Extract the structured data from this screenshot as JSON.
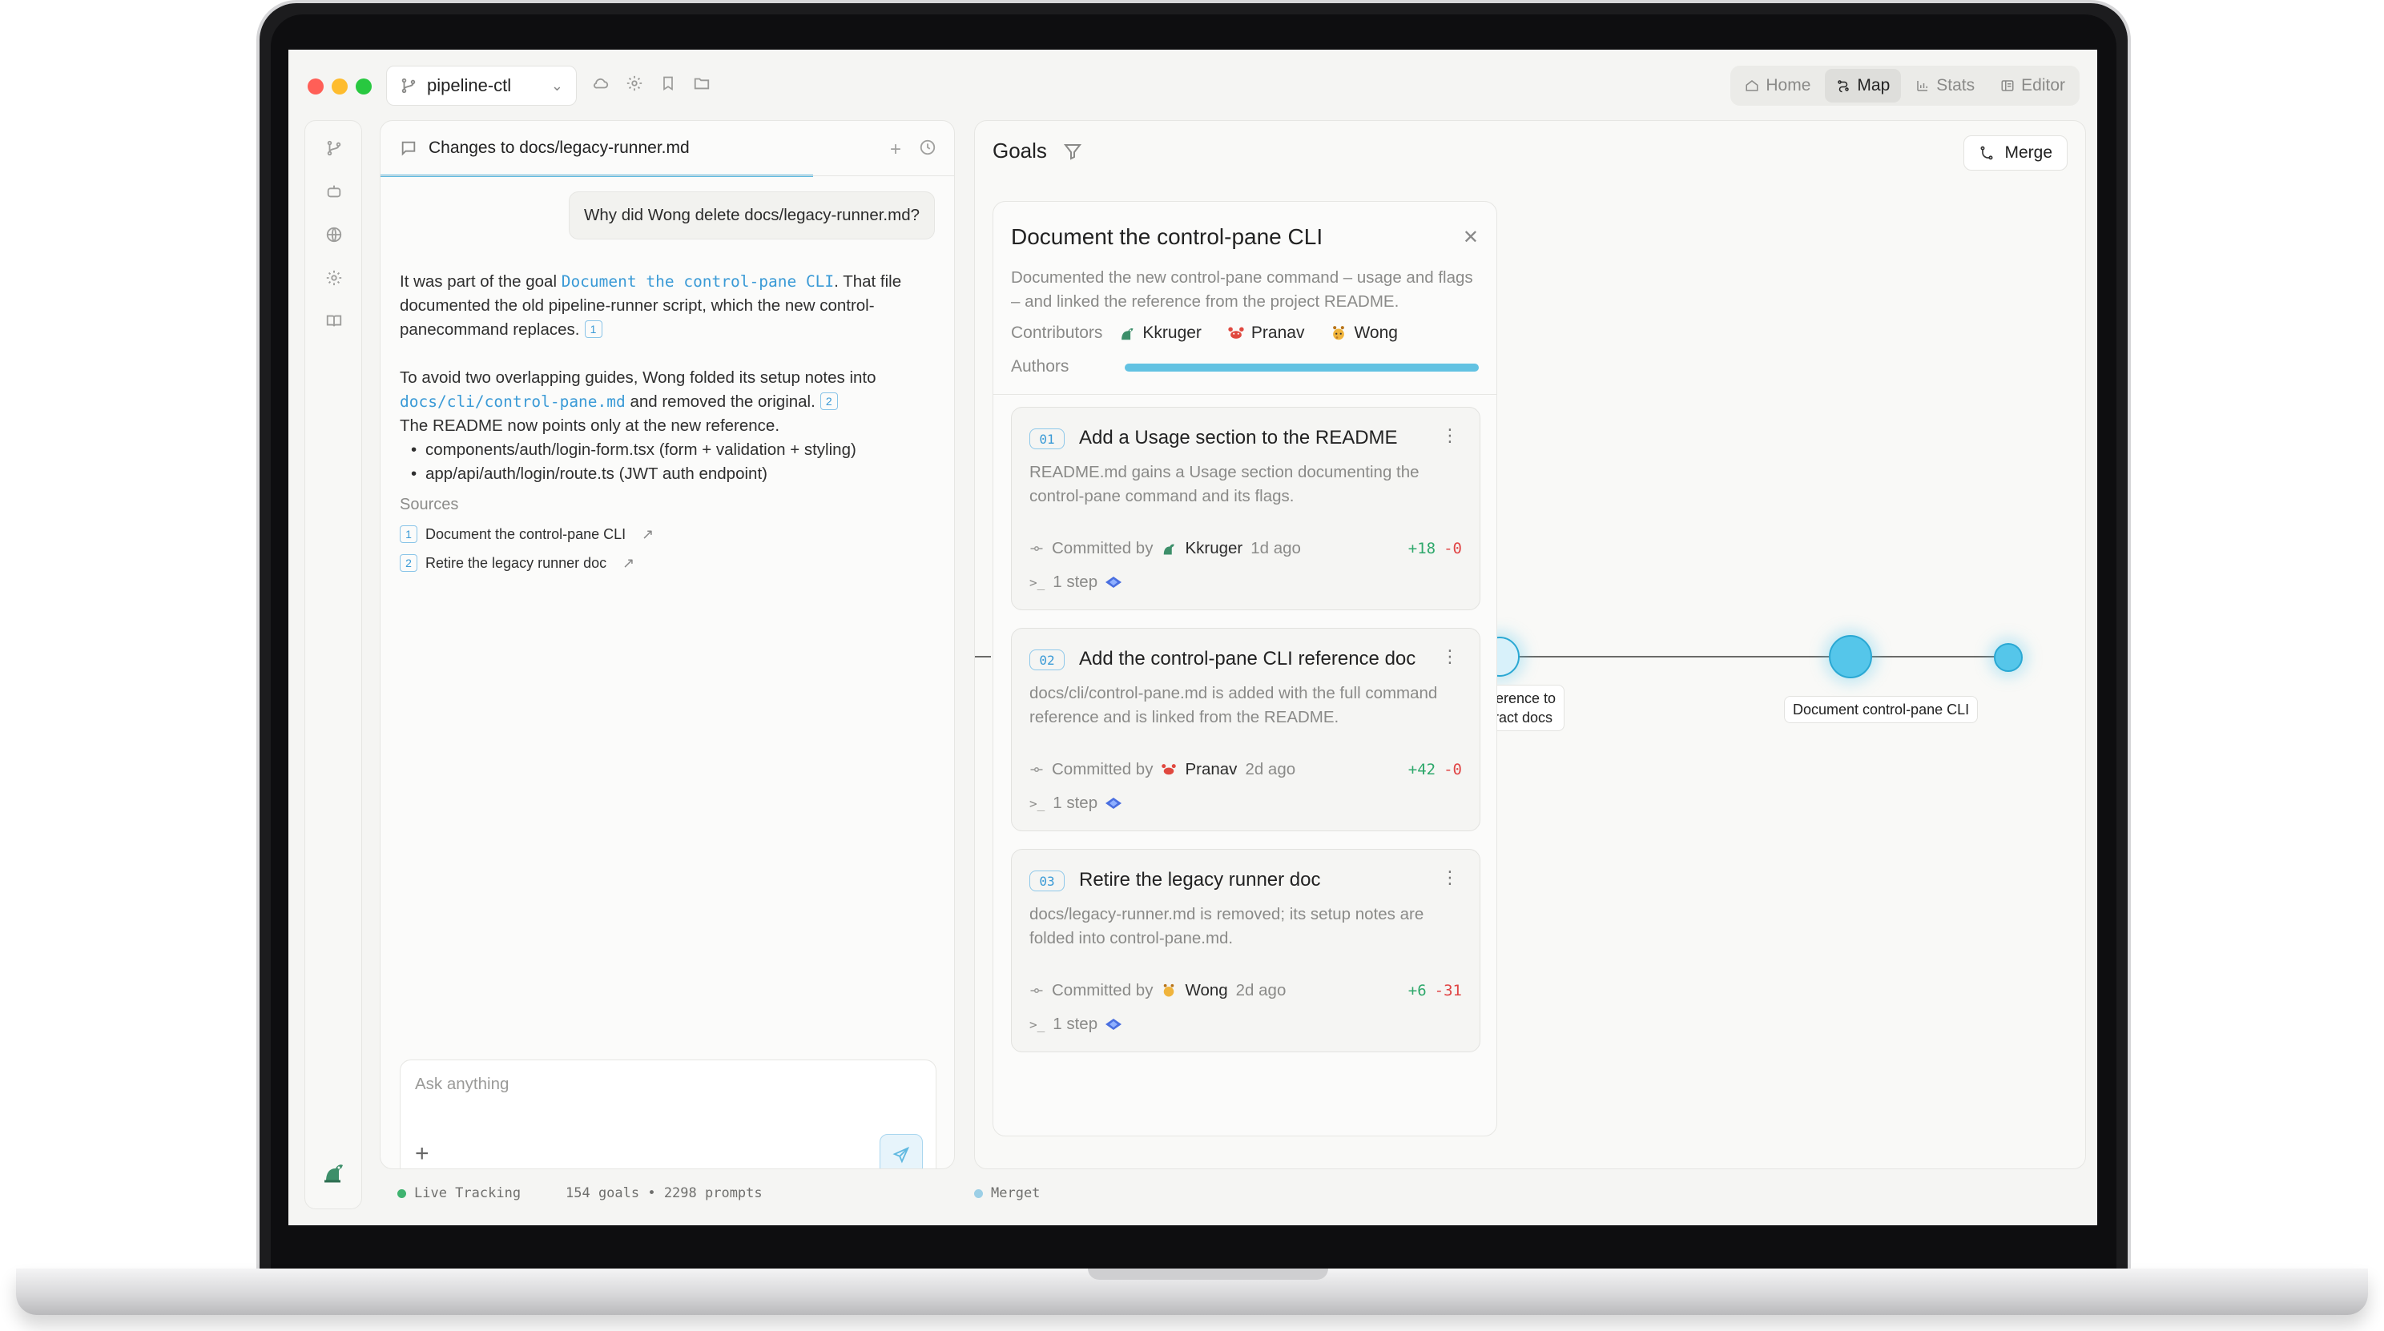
{
  "app": {
    "repo_name": "pipeline-ctl",
    "nav": [
      {
        "label": "Home",
        "icon": "home-icon"
      },
      {
        "label": "Map",
        "icon": "map-icon",
        "active": true
      },
      {
        "label": "Stats",
        "icon": "chart-icon"
      },
      {
        "label": "Editor",
        "icon": "editor-icon"
      }
    ]
  },
  "chat": {
    "tab_title": "Changes to docs/legacy-runner.md",
    "user_question": "Why did Wong delete docs/legacy-runner.md?",
    "answer": {
      "p1_pre": "It was part of the goal ",
      "p1_link": "Document the control-pane CLI",
      "p1_post": ". That file documented the old pipeline-runner script, which the new control-panecommand replaces.",
      "p1_cite": "1",
      "p2_pre": "To avoid two overlapping guides, Wong folded its setup notes into ",
      "p2_link": "docs/cli/control-pane.md",
      "p2_post": " and removed the original.",
      "p2_cite": "2",
      "p3": "The README now points only at the new reference.",
      "bullets": [
        "components/auth/login-form.tsx (form + validation + styling)",
        "app/api/auth/login/route.ts (JWT auth endpoint)"
      ]
    },
    "sources_heading": "Sources",
    "sources": [
      {
        "num": "1",
        "label": "Document the control-pane CLI"
      },
      {
        "num": "2",
        "label": "Retire the legacy runner doc"
      }
    ],
    "compose_placeholder": "Ask anything"
  },
  "goals": {
    "title": "Goals",
    "merge_label": "Merge",
    "graph_labels": {
      "left": "-reference to\nontract docs",
      "middle": "Document control-pane CLI"
    },
    "card": {
      "title": "Document the control-pane CLI",
      "description": "Documented the new control-pane command – usage and flags – and linked the reference from the project README.",
      "contributors_label": "Contributors",
      "contributors": [
        {
          "name": "Kkruger",
          "icon": "dino-avatar-icon"
        },
        {
          "name": "Pranav",
          "icon": "crab-avatar-icon"
        },
        {
          "name": "Wong",
          "icon": "giraffe-avatar-icon"
        }
      ],
      "authors_label": "Authors",
      "steps": [
        {
          "num": "01",
          "title": "Add a Usage section to the README",
          "description": "README.md gains a Usage section documenting the control-pane command and its flags.",
          "committed_by": "Committed by",
          "author": "Kkruger",
          "author_icon": "dino-avatar-icon",
          "time": "1d ago",
          "added": "+18",
          "removed": "-0",
          "steps_label": "1 step"
        },
        {
          "num": "02",
          "title": "Add the control-pane CLI reference doc",
          "description": "docs/cli/control-pane.md is added with the full command reference and is linked from the README.",
          "committed_by": "Committed by",
          "author": "Pranav",
          "author_icon": "crab-avatar-icon",
          "time": "2d ago",
          "added": "+42",
          "removed": "-0",
          "steps_label": "1 step"
        },
        {
          "num": "03",
          "title": "Retire the legacy runner doc",
          "description": "docs/legacy-runner.md is removed; its setup notes are folded into control-pane.md.",
          "committed_by": "Committed by",
          "author": "Wong",
          "author_icon": "giraffe-avatar-icon",
          "time": "2d ago",
          "added": "+6",
          "removed": "-31",
          "steps_label": "1 step"
        }
      ]
    }
  },
  "status": {
    "live": "Live Tracking",
    "counts": "154 goals • 2298 prompts",
    "brand": "Merget"
  },
  "colors": {
    "accent": "#5fb8e0",
    "node": "#55c6ea",
    "added": "#2ea86b",
    "removed": "#e04545",
    "live_dot": "#3fb36f"
  }
}
